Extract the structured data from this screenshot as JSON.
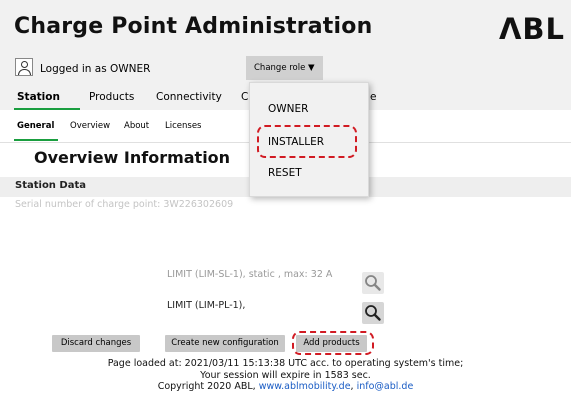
{
  "header": {
    "title": "Charge Point Administration",
    "logo": "ΛBL",
    "logged_in_text": "Logged in as OWNER",
    "change_role_label": "Change role ▼"
  },
  "main_tabs": [
    {
      "label": "Station",
      "active": true
    },
    {
      "label": "Products"
    },
    {
      "label": "Connectivity"
    },
    {
      "label": "C"
    },
    {
      "label": "e"
    }
  ],
  "sub_tabs": [
    {
      "label": "General",
      "active": true
    },
    {
      "label": "Overview"
    },
    {
      "label": "About"
    },
    {
      "label": "Licenses"
    }
  ],
  "role_menu": {
    "items": [
      "OWNER",
      "INSTALLER",
      "RESET"
    ]
  },
  "overview": {
    "title": "Overview Information",
    "section_label": "Station Data",
    "serial_text": "Serial number of charge point:   3W226302609"
  },
  "limits": [
    {
      "text": "LIMIT (LIM-SL-1),  static , max: 32  A"
    },
    {
      "text": "LIMIT (LIM-PL-1),"
    }
  ],
  "buttons": {
    "discard": "Discard changes",
    "create": "Create new configuration",
    "add_products": "Add products"
  },
  "footer": {
    "line1": "Page loaded at: 2021/03/11 15:13:38 UTC acc. to operating system's time;",
    "line2": "Your session will expire in 1583 sec.",
    "line3_prefix": "Copyright 2020 ABL, ",
    "link1": "www.ablmobility.de",
    "separator": ", ",
    "link2": "info@abl.de"
  },
  "colors": {
    "accent_green": "#1a9e3f",
    "highlight_red": "#d11b23",
    "link_blue": "#1a5cc4"
  },
  "icons": [
    "user-icon",
    "search-icon"
  ]
}
